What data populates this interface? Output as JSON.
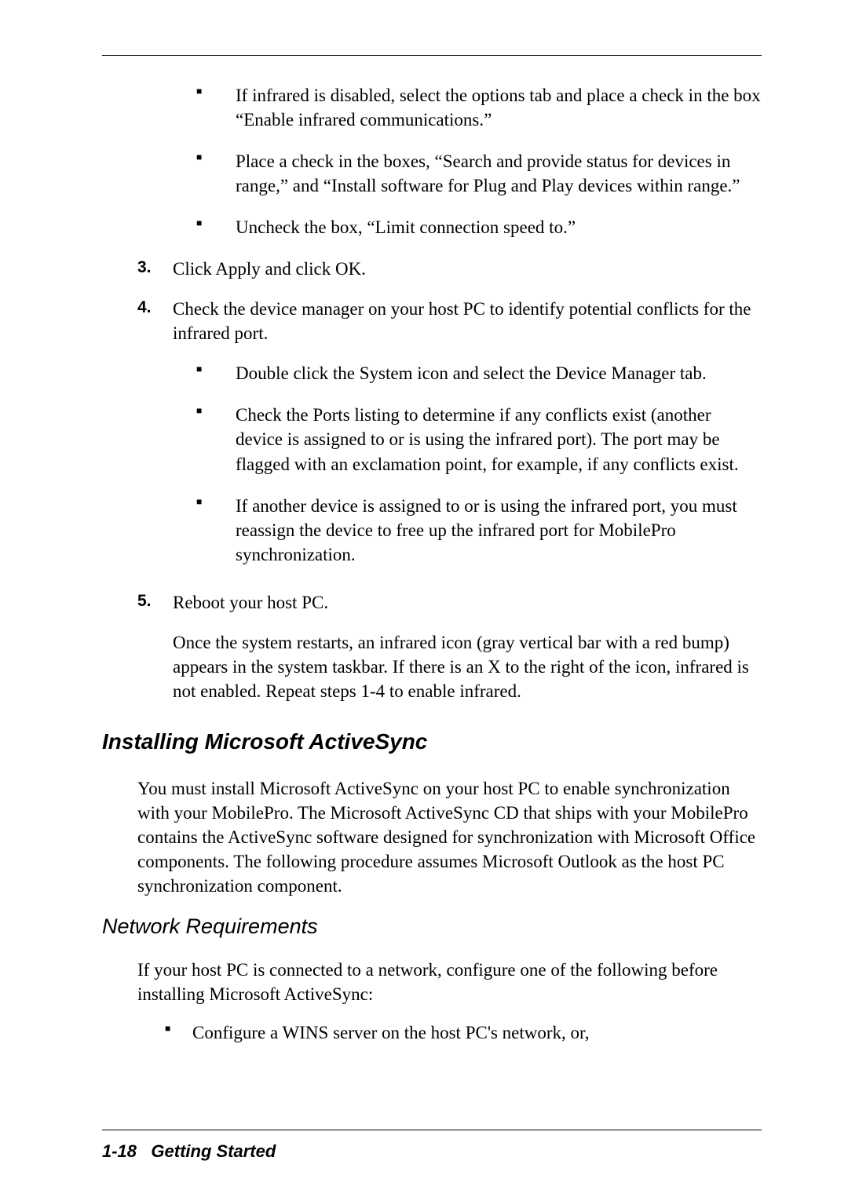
{
  "bullets_top": [
    "If infrared is disabled, select the options tab and place a check in the box “Enable infrared communications.”",
    "Place a check in the boxes, “Search and provide status for devices in range,” and “Install software for Plug and Play devices within range.”",
    "Uncheck the box, “Limit connection speed to.”"
  ],
  "step3": {
    "num": "3.",
    "text": "Click Apply and click OK."
  },
  "step4": {
    "num": "4.",
    "text": "Check the device manager on your host PC to identify potential conflicts for the infrared port.",
    "bullets": [
      "Double click the System icon and select the Device Manager tab.",
      "Check the Ports listing to determine if any conflicts exist (another device is assigned to or is using the infrared port). The port may be flagged with an exclamation point, for example, if any conflicts exist.",
      "If another device is assigned to or is using the infrared port, you must reassign the device to free up the infrared port for MobilePro synchronization."
    ]
  },
  "step5": {
    "num": "5.",
    "text": "Reboot your host PC.",
    "followup": "Once the system restarts, an infrared icon (gray vertical bar with a red bump) appears in the system taskbar. If there is an X to the right of the icon, infrared is not enabled. Repeat steps 1-4 to enable infrared."
  },
  "heading_h2": "Installing Microsoft ActiveSync",
  "para_h2": "You must install Microsoft ActiveSync on your host PC to enable synchronization with your MobilePro. The Microsoft ActiveSync CD that ships with your MobilePro contains the ActiveSync software designed for synchronization with Microsoft Office components. The following procedure assumes Microsoft Outlook as the host PC synchronization component.",
  "heading_h3": "Network Requirements",
  "para_h3": "If your host PC is connected to a network, configure one of the following before installing Microsoft ActiveSync:",
  "bullets_h3": [
    "Configure a WINS server on the host PC's network, or,"
  ],
  "footer": {
    "page": "1-18",
    "section": "Getting Started"
  }
}
